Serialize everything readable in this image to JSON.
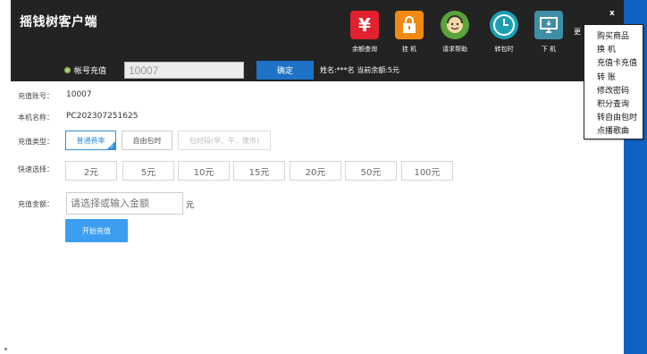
{
  "app": {
    "title": "摇钱树客户端"
  },
  "toolbar": [
    {
      "icon": "yuan-icon",
      "glyph": "¥",
      "label": "余额查询"
    },
    {
      "icon": "lock-icon",
      "glyph": "🔒",
      "label": "挂 机"
    },
    {
      "icon": "help-icon",
      "glyph": "☺",
      "label": "请求帮助"
    },
    {
      "icon": "clock-icon",
      "glyph": "◷",
      "label": "转包时"
    },
    {
      "icon": "exit-icon",
      "glyph": "▭",
      "label": "下 机"
    }
  ],
  "account_bar": {
    "radio_label": "帐号充值",
    "account_value": "10007",
    "confirm": "确定",
    "info": "姓名:***名  当前余额:5元"
  },
  "form": {
    "account_label": "充值账号：",
    "account_value": "10007",
    "machine_label": "本机名称：",
    "machine_value": "PC202307251625",
    "type_label": "充值类型：",
    "types": [
      "普通费率",
      "自由包时",
      "包时段(早、午、夜市)"
    ],
    "quick_label": "快速选择：",
    "quick_amounts": [
      "2元",
      "5元",
      "10元",
      "15元",
      "20元",
      "50元",
      "100元"
    ],
    "amount_label": "充值金额：",
    "amount_placeholder": "请选择或输入金额",
    "unit": "元",
    "start": "开始充值"
  },
  "panel": {
    "peek_text": "更",
    "close": "x"
  },
  "menu": [
    "购买商品",
    "换  机",
    "充值卡充值",
    "转  账",
    "修改密码",
    "积分查询",
    "转自由包时",
    "点播歌曲"
  ],
  "colors": {
    "topbar": "#232323",
    "accent": "#1e73c6",
    "panel": "#0f62c2",
    "active": "#2f8fe0"
  }
}
